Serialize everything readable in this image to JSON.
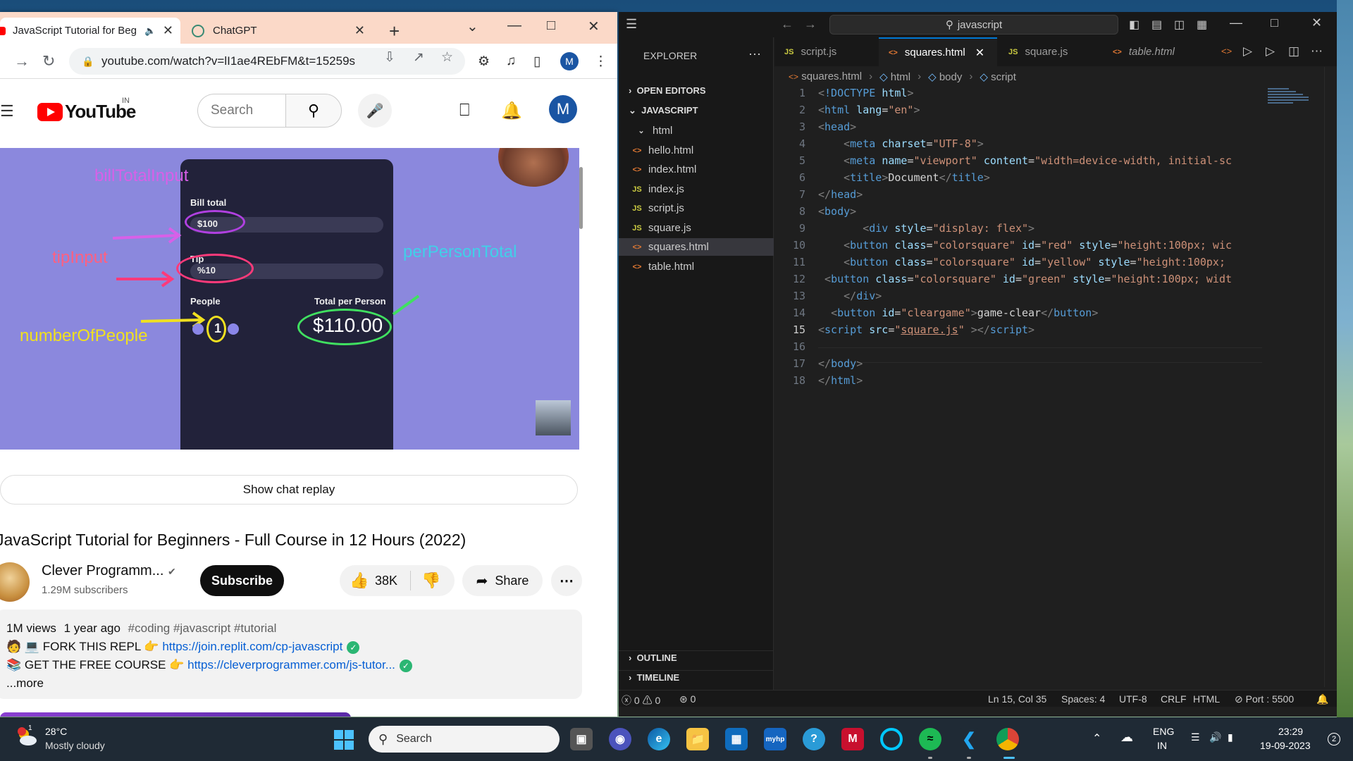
{
  "chrome": {
    "tabs": [
      {
        "title": "JavaScript Tutorial for Beg",
        "active": true
      },
      {
        "title": "ChatGPT",
        "active": false
      }
    ],
    "url": "youtube.com/watch?v=lI1ae4REbFM&t=15259s",
    "profile_initial": "M"
  },
  "youtube": {
    "logo_text": "YouTube",
    "country_code": "IN",
    "search_placeholder": "Search",
    "avatar_initial": "M",
    "video_overlay": {
      "bill_label": "Bill total",
      "bill_value": "$100",
      "tip_label": "Tip",
      "tip_value": "%10",
      "people_label": "People",
      "people_value": "1",
      "total_label": "Total per Person",
      "total_value": "$110.00",
      "annotations": {
        "bill": "billTotalInput",
        "tip": "tipInput",
        "people": "numberOfPeople",
        "per_person": "perPersonTotal"
      }
    },
    "chat_replay_label": "Show chat replay",
    "video_title": "JavaScript Tutorial for Beginners - Full Course in 12 Hours (2022)",
    "channel_name": "Clever Programm...",
    "subscribers": "1.29M subscribers",
    "subscribe_label": "Subscribe",
    "likes": "38K",
    "share_label": "Share",
    "description": {
      "views": "1M views",
      "age": "1 year ago",
      "tags": "#coding #javascript #tutorial",
      "line1_text": "FORK THIS REPL",
      "line1_link": "https://join.replit.com/cp-javascript",
      "line2_text": "GET THE FREE COURSE",
      "line2_link": "https://cleverprogrammer.com/js-tutor...",
      "more": "...more"
    }
  },
  "vscode": {
    "command_center": "javascript",
    "explorer_title": "EXPLORER",
    "sections": {
      "open_editors": "OPEN EDITORS",
      "folder": "JAVASCRIPT",
      "outline": "OUTLINE",
      "timeline": "TIMELINE"
    },
    "files": [
      {
        "name": "html",
        "type": "folder"
      },
      {
        "name": "hello.html",
        "type": "html"
      },
      {
        "name": "index.html",
        "type": "html"
      },
      {
        "name": "index.js",
        "type": "js"
      },
      {
        "name": "script.js",
        "type": "js"
      },
      {
        "name": "square.js",
        "type": "js"
      },
      {
        "name": "squares.html",
        "type": "html",
        "active": true
      },
      {
        "name": "table.html",
        "type": "html"
      }
    ],
    "editor_tabs": [
      {
        "name": "script.js",
        "type": "js"
      },
      {
        "name": "squares.html",
        "type": "html",
        "active": true
      },
      {
        "name": "square.js",
        "type": "js"
      },
      {
        "name": "table.html",
        "type": "html",
        "italic": true
      }
    ],
    "breadcrumbs": [
      "squares.html",
      "html",
      "body",
      "script"
    ],
    "line_numbers": [
      "1",
      "2",
      "3",
      "4",
      "5",
      "6",
      "7",
      "8",
      "9",
      "10",
      "11",
      "12",
      "13",
      "14",
      "15",
      "16",
      "17",
      "18"
    ],
    "current_line": 15,
    "status": {
      "errors": "0",
      "warnings": "0",
      "ports": "0",
      "position": "Ln 15, Col 35",
      "spaces": "Spaces: 4",
      "encoding": "UTF-8",
      "eol": "CRLF",
      "language": "HTML",
      "port": "Port : 5500"
    }
  },
  "taskbar": {
    "weather_temp": "28°C",
    "weather_desc": "Mostly cloudy",
    "weather_badge": "1",
    "search_label": "Search",
    "lang_top": "ENG",
    "lang_bottom": "IN",
    "time": "23:29",
    "date": "19-09-2023",
    "notif_count": "2"
  }
}
